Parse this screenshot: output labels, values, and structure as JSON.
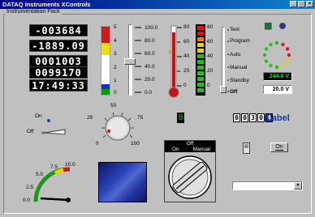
{
  "window": {
    "title": "DATAQ Instruments XControls",
    "min": "_",
    "max": "□",
    "close": "×"
  },
  "panel": {
    "label": "Instrumentation Pack"
  },
  "lcds": [
    "-003684",
    "-1889.09",
    "0001003",
    "0099170",
    "17:49:33"
  ],
  "bar": {
    "scale": [
      "5",
      "4",
      "3",
      "2",
      "1",
      "0"
    ],
    "value_fraction": 0.08
  },
  "slider": {
    "scale": [
      "100.0",
      "80.0",
      "60.0",
      "40.0",
      "20.0",
      "0.0"
    ],
    "value": 40.0
  },
  "thermometer": {
    "scale": [
      "80",
      "60",
      "40",
      "20",
      "0"
    ],
    "value": 72
  },
  "ledbar": {
    "scale": [
      "80",
      "60",
      "40",
      "20",
      "0"
    ]
  },
  "switch_labels": [
    "Test",
    "Program",
    "Auto",
    "Manual",
    "Standby",
    "Off"
  ],
  "volts": {
    "top": "244.0 V",
    "bottom": "20.0 V"
  },
  "toggle": {
    "on": "On",
    "off": "Off"
  },
  "knob": {
    "ticks": [
      "0",
      "25",
      "50",
      "75",
      "100"
    ],
    "value": 10
  },
  "digital_single": "8",
  "digits": [
    "0",
    "0",
    "3",
    "0",
    "4"
  ],
  "ilabel": "iLabel",
  "onbutton": "On",
  "gauge": {
    "ticks": [
      "0.0",
      "2.5",
      "5.0",
      "7.5",
      "10.0"
    ],
    "value": 8.9
  },
  "mode_switch": {
    "title": "Off",
    "left": "On",
    "right": "Manual"
  },
  "colors": {
    "title_start": "#000080",
    "title_end": "#1084d0",
    "ilabel": "#1c3c9c",
    "readout_black": "#000000",
    "readout_green": "#1c8f1c"
  }
}
